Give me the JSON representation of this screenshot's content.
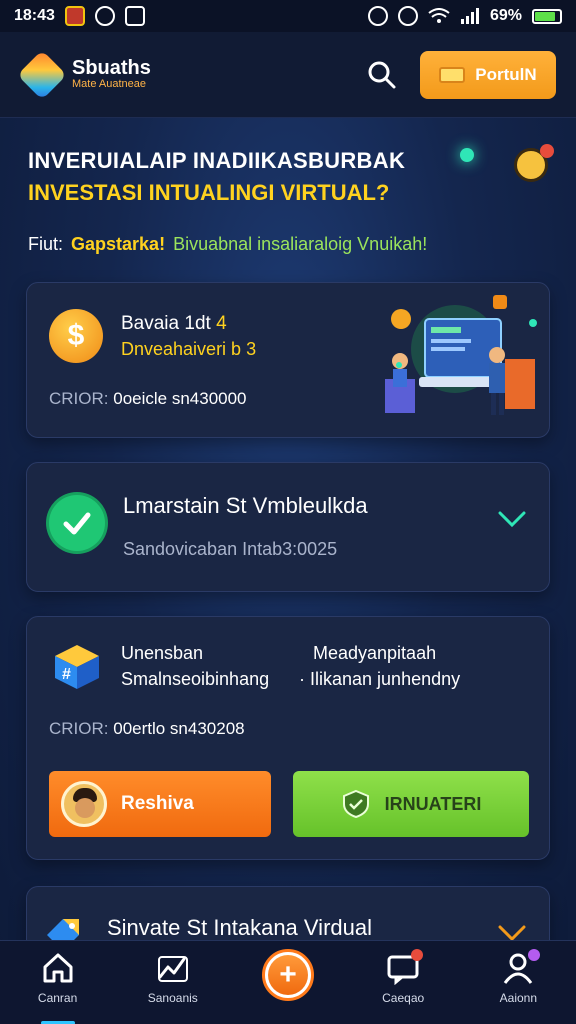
{
  "status_bar": {
    "time": "18:43",
    "battery": "69%"
  },
  "header": {
    "brand_name": "Sbuaths",
    "brand_tagline": "Mate Auatneae",
    "portal_button_label": "PortulN"
  },
  "hero": {
    "line1": "INVERUIALAIP INADIIKASBURBAK",
    "line2": "INVESTASI INTUALINGI VIRTUAL?",
    "sub_prefix": "Fiut:",
    "sub_highlight": "Gapstarka!",
    "sub_suffix": "Bivuabnal insaliaraloig Vnuikah!"
  },
  "card_investment": {
    "title_prefix": "Bavaia 1dt",
    "title_highlight": "4",
    "subtitle": "Dnveahaiveri b 3",
    "meta_label": "CRIOR:",
    "meta_value": "0oeicle sn430000"
  },
  "card_status": {
    "title": "Lmarstain St Vmbleulkda",
    "subtitle": "Sandovicaban Intab3:0025"
  },
  "card_actions": {
    "col1_line1": "Unensban",
    "col1_line2": "Smalnseoibinhang",
    "col2_line1": "Meadyanpitaah",
    "col2_line2": "Ilikanan junhendny",
    "meta_label": "CRIOR:",
    "meta_value": "00ertlo sn430208",
    "orange_button_label": "Reshiva",
    "green_button_label": "IRNUATERI"
  },
  "card_more": {
    "title": "Sinvate St Intakana Virdual"
  },
  "bottom_nav": {
    "items": [
      {
        "label": "Canran",
        "icon": "home-icon"
      },
      {
        "label": "Sanoanis",
        "icon": "chart-icon"
      },
      {
        "label": "",
        "icon": "plus-icon"
      },
      {
        "label": "Caeqao",
        "icon": "message-icon"
      },
      {
        "label": "Aaionn",
        "icon": "user-icon"
      }
    ]
  },
  "colors": {
    "accent_orange": "#f39a1a",
    "accent_yellow": "#ffd21f",
    "accent_green": "#66c22a",
    "card_bg": "#1a2644",
    "page_bg": "#14264e"
  }
}
